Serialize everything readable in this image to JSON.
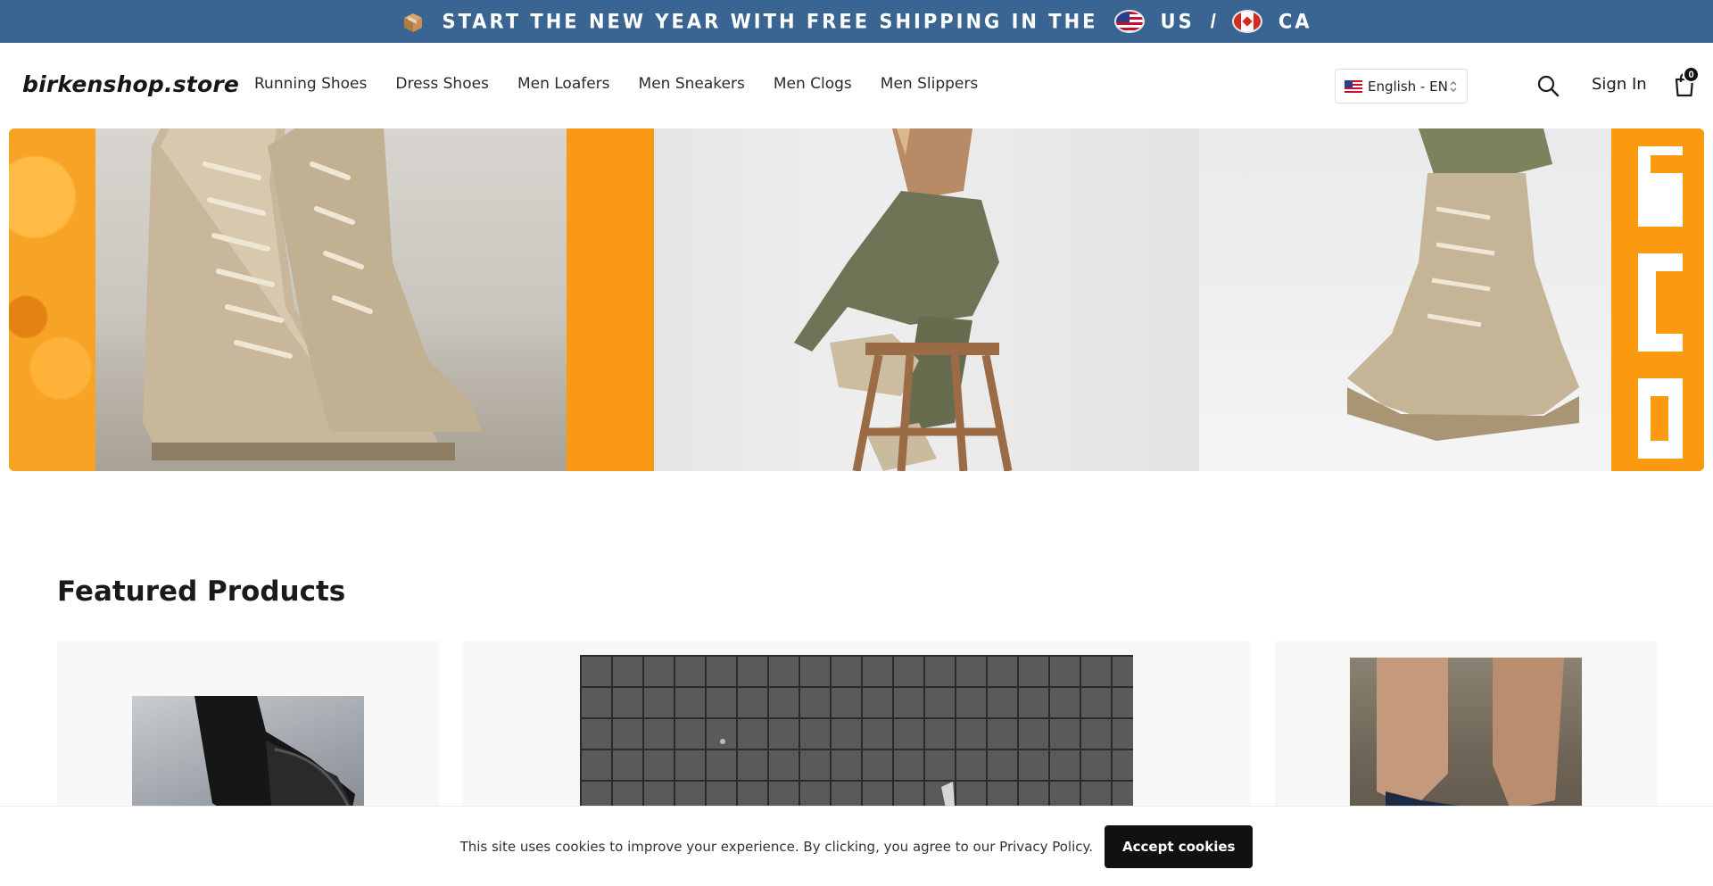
{
  "announcement": {
    "text": "START THE NEW YEAR WITH FREE SHIPPING IN THE",
    "us_label": "US",
    "separator": "/",
    "ca_label": "CA",
    "bg_color": "#3a6592"
  },
  "header": {
    "logo": "birkenshop.store",
    "nav": [
      {
        "label": "Running Shoes"
      },
      {
        "label": "Dress Shoes"
      },
      {
        "label": "Men Loafers"
      },
      {
        "label": "Men Sneakers"
      },
      {
        "label": "Men Clogs"
      },
      {
        "label": "Men Slippers"
      }
    ],
    "language": "English - EN",
    "sign_in": "Sign In",
    "cart_count": "0",
    "icons": [
      "search-icon",
      "cart-icon",
      "chevron-updown-icon"
    ]
  },
  "featured": {
    "title": "Featured Products"
  },
  "cookie": {
    "message": "This site uses cookies to improve your experience. By clicking, you agree to our Privacy Policy.",
    "accept_label": "Accept cookies"
  }
}
